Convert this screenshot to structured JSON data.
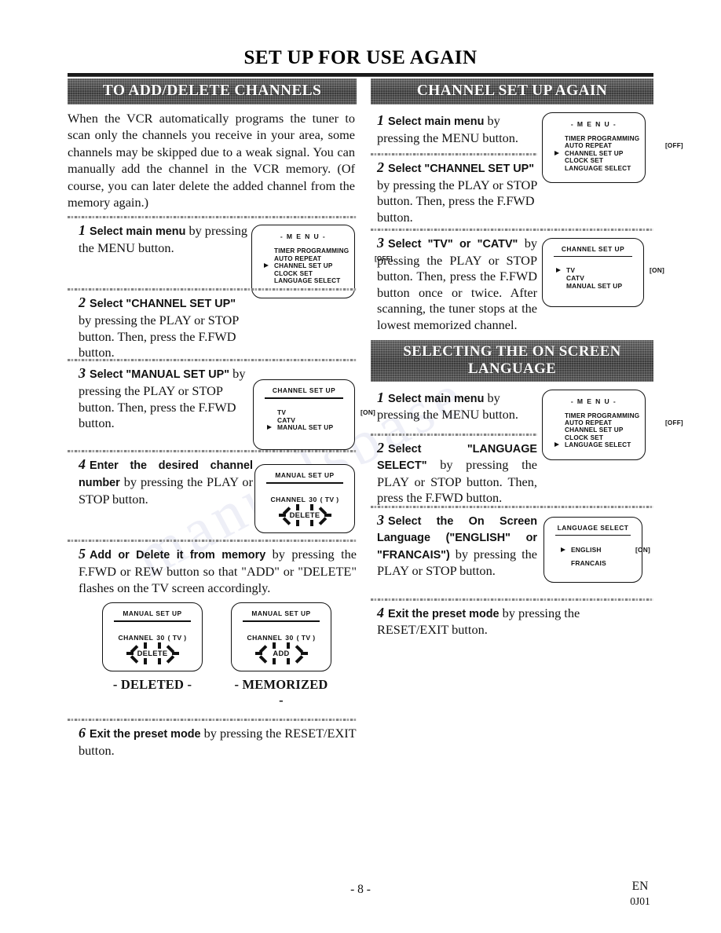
{
  "page": {
    "main_title": "SET UP FOR USE AGAIN",
    "footer_page": "- 8 -",
    "footer_region": "EN",
    "footer_code": "0J01",
    "watermark": "manualsbase"
  },
  "left_column": {
    "section_title": "TO ADD/DELETE CHANNELS",
    "intro": "When the VCR automatically programs the tuner to scan only the channels you receive in your area, some channels may be skipped due to a weak signal. You can manually add the channel in the VCR memory. (Of course, you can later delete the added channel from the memory again.)",
    "steps": [
      {
        "number": "1",
        "bold": "Select main menu",
        "rest": " by pressing the MENU button."
      },
      {
        "number": "2",
        "bold": "Select \"CHANNEL SET UP\"",
        "rest": " by pressing the PLAY or STOP button. Then, press the F.FWD button."
      },
      {
        "number": "3",
        "bold": "Select \"MANUAL SET UP\"",
        "rest": " by pressing the PLAY or STOP button. Then, press the F.FWD button."
      },
      {
        "number": "4",
        "bold": "Enter the desired channel number",
        "rest": " by pressing the PLAY or STOP button."
      },
      {
        "number": "5",
        "bold": "Add or Delete it from memory",
        "rest": " by pressing the F.FWD or REW button so that \"ADD\" or \"DELETE\" flashes on the TV screen accordingly."
      },
      {
        "number": "6",
        "bold": "Exit the preset mode",
        "rest": " by pressing the RESET/EXIT button."
      }
    ],
    "screen_menu": {
      "title": "- M E N U -",
      "rows": [
        {
          "label": "TIMER PROGRAMMING",
          "value": "",
          "selected": false
        },
        {
          "label": "AUTO REPEAT",
          "value": "[OFF]",
          "selected": false
        },
        {
          "label": "CHANNEL SET UP",
          "value": "",
          "selected": true
        },
        {
          "label": "CLOCK SET",
          "value": "",
          "selected": false
        },
        {
          "label": "LANGUAGE SELECT",
          "value": "",
          "selected": false
        }
      ]
    },
    "screen_channel_setup": {
      "title": "CHANNEL SET UP",
      "rows": [
        {
          "label": "TV",
          "value": "[ON]",
          "selected": false
        },
        {
          "label": "CATV",
          "value": "",
          "selected": false
        },
        {
          "label": "MANUAL SET UP",
          "value": "",
          "selected": true
        }
      ]
    },
    "screen_manual_setup": {
      "title": "MANUAL SET UP",
      "channel_label": "CHANNEL",
      "channel_number": "30",
      "channel_source": "( TV )",
      "flash_word": "DELETE"
    },
    "screen_deleted": {
      "title": "MANUAL SET UP",
      "channel_label": "CHANNEL",
      "channel_number": "30",
      "channel_source": "( TV )",
      "flash_word": "DELETE",
      "caption": "- DELETED -"
    },
    "screen_memorized": {
      "title": "MANUAL SET UP",
      "channel_label": "CHANNEL",
      "channel_number": "30",
      "channel_source": "( TV )",
      "flash_word": "ADD",
      "caption": "- MEMORIZED -"
    }
  },
  "right_column": {
    "section_title": "CHANNEL SET UP AGAIN",
    "steps": [
      {
        "number": "1",
        "bold": "Select main menu",
        "rest": " by pressing the MENU button."
      },
      {
        "number": "2",
        "bold": "Select \"CHANNEL SET UP\"",
        "rest": " by pressing the PLAY or STOP button. Then, press the F.FWD button."
      },
      {
        "number": "3",
        "bold": "Select \"TV\" or \"CATV\"",
        "rest": " by pressing the PLAY or STOP button. Then, press the F.FWD button once or twice. After scanning, the tuner stops at the lowest memorized channel."
      }
    ],
    "screen_menu": {
      "title": "- M E N U -",
      "rows": [
        {
          "label": "TIMER PROGRAMMING",
          "value": "",
          "selected": false
        },
        {
          "label": "AUTO REPEAT",
          "value": "[OFF]",
          "selected": false
        },
        {
          "label": "CHANNEL SET UP",
          "value": "",
          "selected": true
        },
        {
          "label": "CLOCK SET",
          "value": "",
          "selected": false
        },
        {
          "label": "LANGUAGE SELECT",
          "value": "",
          "selected": false
        }
      ]
    },
    "screen_channel_setup": {
      "title": "CHANNEL SET UP",
      "rows": [
        {
          "label": "TV",
          "value": "[ON]",
          "selected": true
        },
        {
          "label": "CATV",
          "value": "",
          "selected": false
        },
        {
          "label": "MANUAL SET UP",
          "value": "",
          "selected": false
        }
      ]
    }
  },
  "language_section": {
    "section_title_line1": "SELECTING THE ON SCREEN",
    "section_title_line2": "LANGUAGE",
    "steps": [
      {
        "number": "1",
        "bold": "Select main menu",
        "rest": " by pressing the MENU button."
      },
      {
        "number": "2",
        "bold": "Select \"LANGUAGE SELECT\"",
        "rest": " by pressing the PLAY or STOP button. Then, press the F.FWD button."
      },
      {
        "number": "3",
        "bold": "Select the On Screen Language (\"ENGLISH\" or \"FRANCAIS\")",
        "rest": " by pressing the PLAY or STOP button."
      },
      {
        "number": "4",
        "bold": "Exit the preset mode",
        "rest": " by pressing the RESET/EXIT button."
      }
    ],
    "screen_menu": {
      "title": "- M E N U -",
      "rows": [
        {
          "label": "TIMER PROGRAMMING",
          "value": "",
          "selected": false
        },
        {
          "label": "AUTO REPEAT",
          "value": "[OFF]",
          "selected": false
        },
        {
          "label": "CHANNEL SET UP",
          "value": "",
          "selected": false
        },
        {
          "label": "CLOCK SET",
          "value": "",
          "selected": false
        },
        {
          "label": "LANGUAGE SELECT",
          "value": "",
          "selected": true
        }
      ]
    },
    "screen_language_select": {
      "title": "LANGUAGE SELECT",
      "rows": [
        {
          "label": "ENGLISH",
          "value": "[ON]",
          "selected": true
        },
        {
          "label": "FRANCAIS",
          "value": "",
          "selected": false
        }
      ]
    }
  }
}
